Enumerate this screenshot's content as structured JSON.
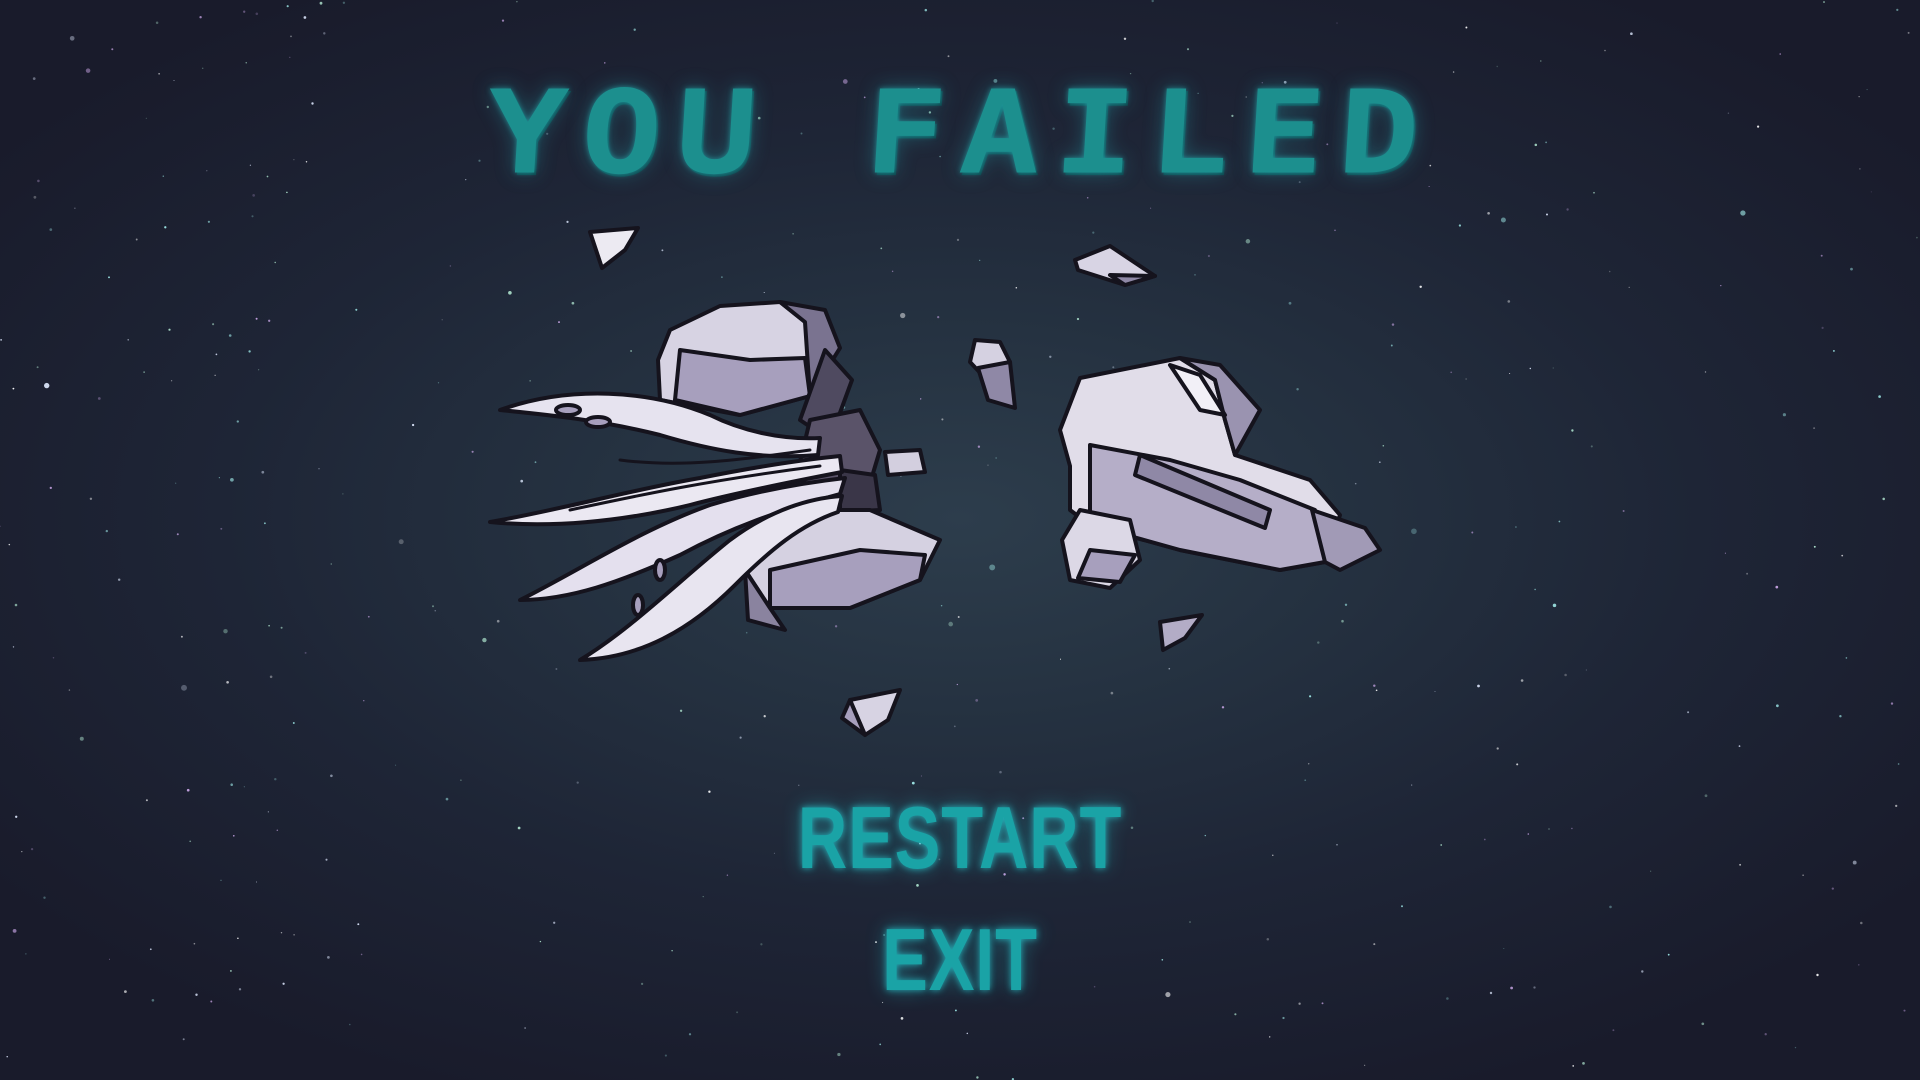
{
  "title": "YOU FAILED",
  "menu": {
    "restart_label": "RESTART",
    "exit_label": "EXIT"
  },
  "colors": {
    "accent": "#1c8f8e",
    "menu_text": "#1aa3a6",
    "background": "#1e2536",
    "debris_light": "#e6e3ef",
    "debris_shade": "#a79fbd",
    "outline": "#15131d"
  },
  "icons": {
    "ship": "destroyed-ship-icon"
  }
}
